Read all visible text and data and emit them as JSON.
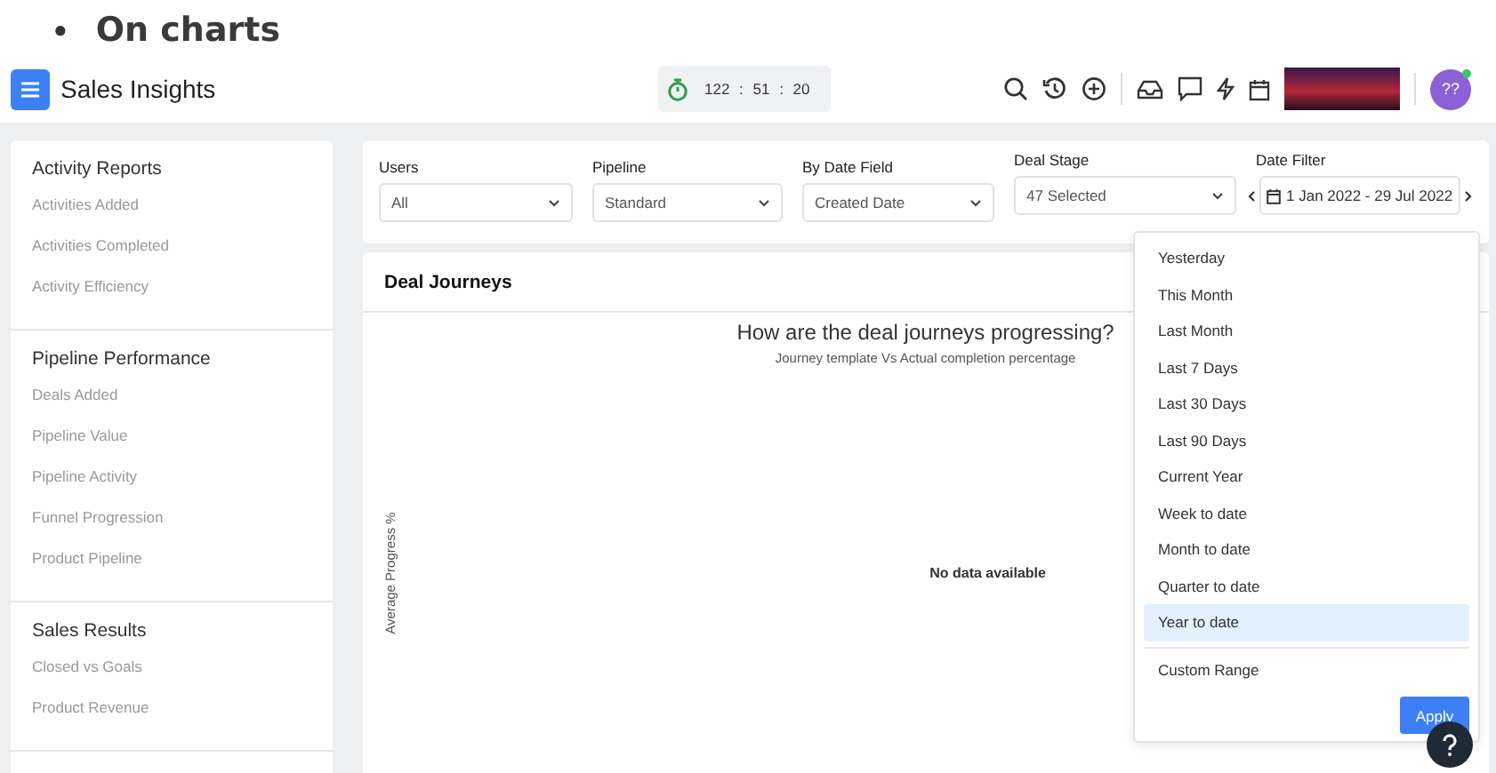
{
  "heading": {
    "bullet": "●",
    "text": "On charts"
  },
  "app_bar": {
    "title": "Sales Insights",
    "timer": "122 : 51 : 20",
    "avatar": {
      "initials": "??",
      "online": true
    }
  },
  "sidebar": {
    "sections": [
      {
        "title": "Activity Reports",
        "items": [
          "Activities Added",
          "Activities Completed",
          "Activity Efficiency"
        ]
      },
      {
        "title": "Pipeline Performance",
        "items": [
          "Deals Added",
          "Pipeline Value",
          "Pipeline Activity",
          "Funnel Progression",
          "Product Pipeline"
        ]
      },
      {
        "title": "Sales Results",
        "items": [
          "Closed vs Goals",
          "Product Revenue"
        ]
      }
    ]
  },
  "filters": [
    {
      "kind": "select",
      "label": "Users",
      "value": "All"
    },
    {
      "kind": "select",
      "label": "Pipeline",
      "value": "Standard"
    },
    {
      "kind": "select",
      "label": "By Date Field",
      "value": "Created Date"
    },
    {
      "kind": "select",
      "label": "Deal Stage",
      "value": "47 Selected"
    },
    {
      "kind": "date",
      "label": "Date Filter",
      "value": "1 Jan 2022 - 29 Jul 2022"
    }
  ],
  "chart_card": {
    "title": "Deal Journeys",
    "chart_title": "How are the deal journeys progressing?",
    "subtitle": "Journey template Vs Actual completion percentage",
    "ylabel": "Average Progress %",
    "empty_message": "No data available"
  },
  "date_menu": {
    "options": [
      {
        "label": "Yesterday",
        "selected": false
      },
      {
        "label": "This Month",
        "selected": false
      },
      {
        "label": "Last Month",
        "selected": false
      },
      {
        "label": "Last 7 Days",
        "selected": false
      },
      {
        "label": "Last 30 Days",
        "selected": false
      },
      {
        "label": "Last 90 Days",
        "selected": false
      },
      {
        "label": "Current Year",
        "selected": false
      },
      {
        "label": "Week to date",
        "selected": false
      },
      {
        "label": "Month to date",
        "selected": false
      },
      {
        "label": "Quarter to date",
        "selected": false
      },
      {
        "label": "Year to date",
        "selected": true
      }
    ],
    "custom": "Custom Range",
    "apply": "Apply"
  }
}
